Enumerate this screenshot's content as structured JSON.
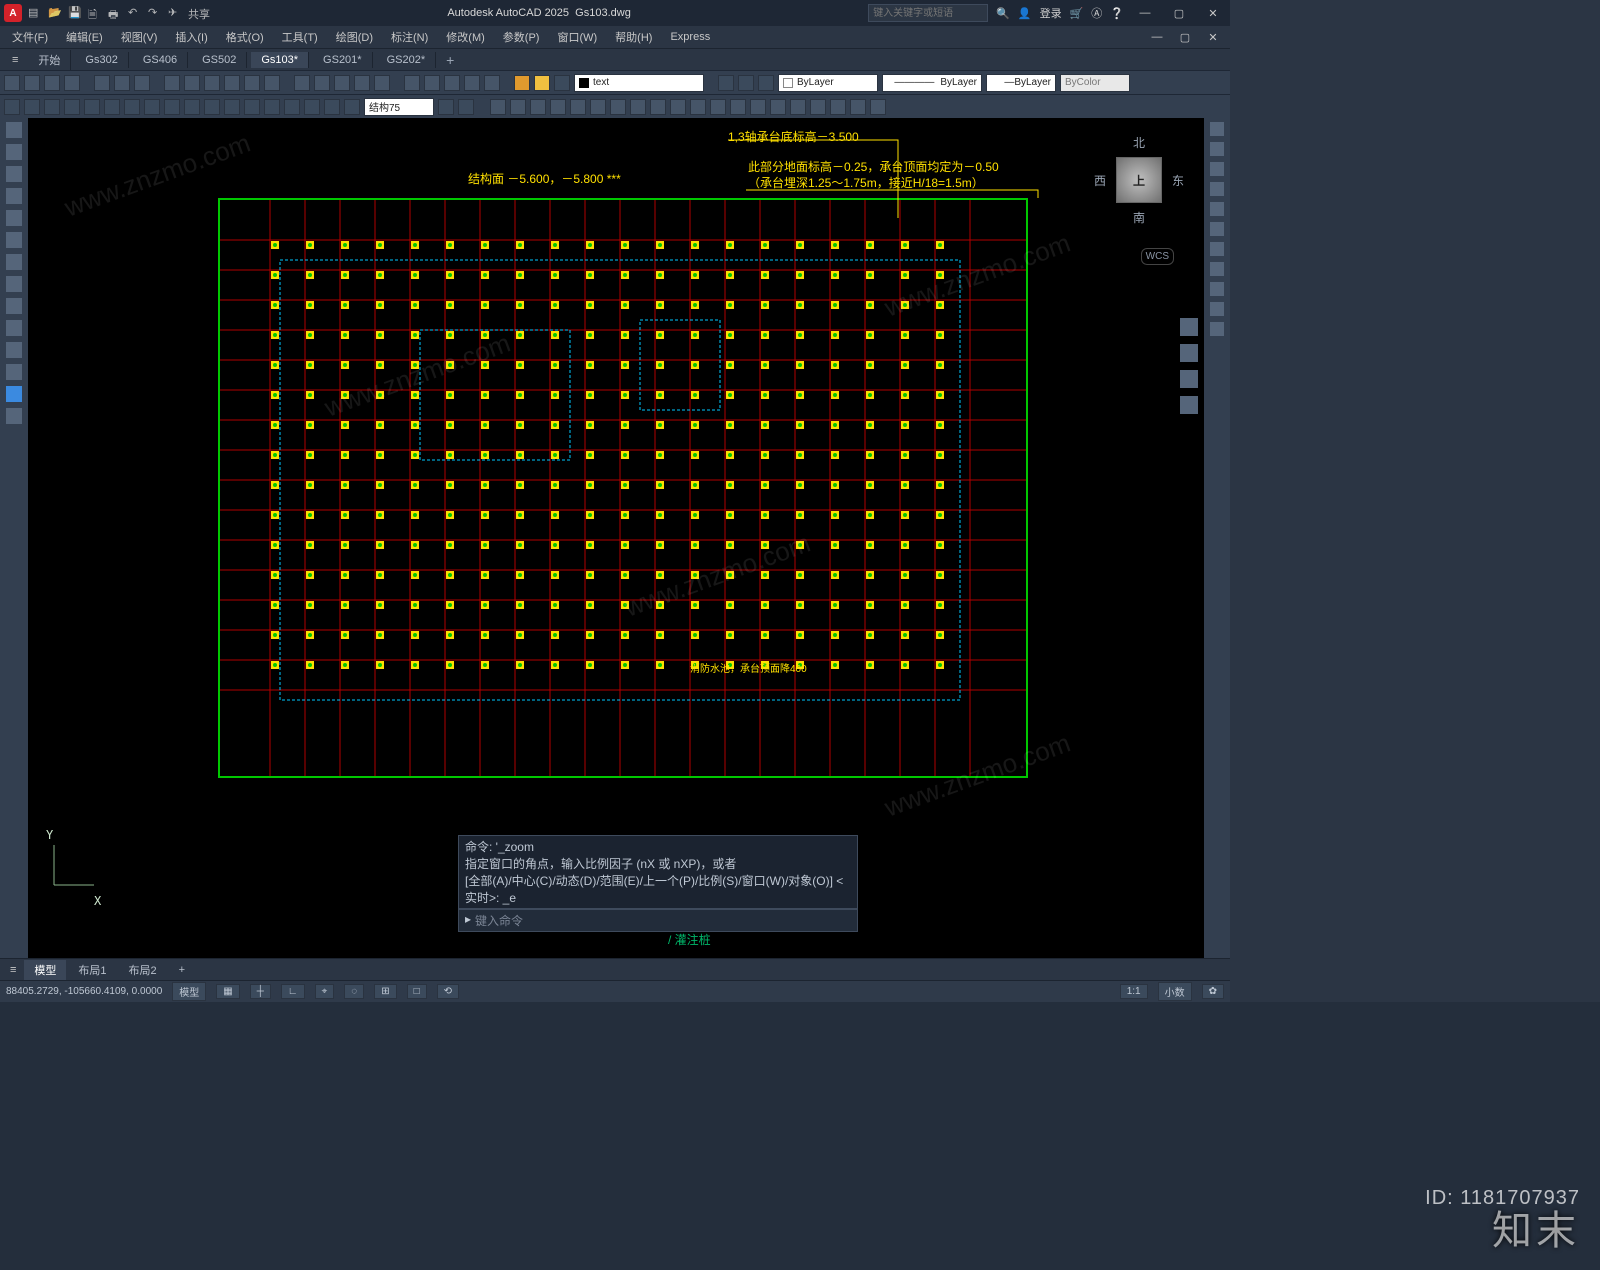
{
  "app": {
    "title_left": "Autodesk AutoCAD 2025",
    "title_file": "Gs103.dwg",
    "logo_letter": "A",
    "search_placeholder": "键入关键字或短语",
    "login": "登录",
    "share": "共享"
  },
  "menu": [
    "文件(F)",
    "编辑(E)",
    "视图(V)",
    "插入(I)",
    "格式(O)",
    "工具(T)",
    "绘图(D)",
    "标注(N)",
    "修改(M)",
    "参数(P)",
    "窗口(W)",
    "帮助(H)",
    "Express"
  ],
  "file_tabs": {
    "start": "开始",
    "items": [
      "Gs302",
      "GS406",
      "GS502",
      "Gs103*",
      "GS201*",
      "GS202*"
    ],
    "active": "Gs103*"
  },
  "ribbon1": {
    "dd_text": "text",
    "layer": "ByLayer",
    "lt": "ByLayer",
    "lw": "ByLayer",
    "color": "ByColor"
  },
  "ribbon2": {
    "dimstyle": "结构75"
  },
  "viewcube": {
    "n": "北",
    "s": "南",
    "e": "东",
    "w": "西",
    "top": "上",
    "wcs": "WCS"
  },
  "drawing": {
    "title_center": "结构面 －5.600，－5.800 ***",
    "anno_top_right": "1,3轴承台底标高－3.500",
    "anno_line1": "此部分地面标高－0.25，承台顶面均定为－0.50",
    "anno_line2": "（承台埋深1.25～1.75m，接近H/18=1.5m）",
    "anno_internal": "消防水池，承台顶面降400",
    "axis_x": "X",
    "axis_y": "Y",
    "footer_note": "/ 灌注桩"
  },
  "cmd": {
    "line1": "命令: '_zoom",
    "line2": "指定窗口的角点，输入比例因子 (nX 或 nXP)，或者",
    "line3": "[全部(A)/中心(C)/动态(D)/范围(E)/上一个(P)/比例(S)/窗口(W)/对象(O)] <实时>: _e",
    "prompt": "键入命令",
    "icon": "▸"
  },
  "bottom_tabs": {
    "items": [
      "模型",
      "布局1",
      "布局2"
    ],
    "active": "模型"
  },
  "status": {
    "coords": "88405.2729, -105660.4109, 0.0000",
    "space": "模型",
    "grid_items": [
      "▦",
      "┼",
      "∟",
      "⌖",
      "◌",
      "⊞",
      "□",
      "⟲"
    ],
    "scale": "1:1",
    "decimal": "小数",
    "gear": "✿"
  },
  "watermark": {
    "brand": "知末",
    "id": "ID: 1181707937",
    "url": "www.znzmo.com"
  }
}
